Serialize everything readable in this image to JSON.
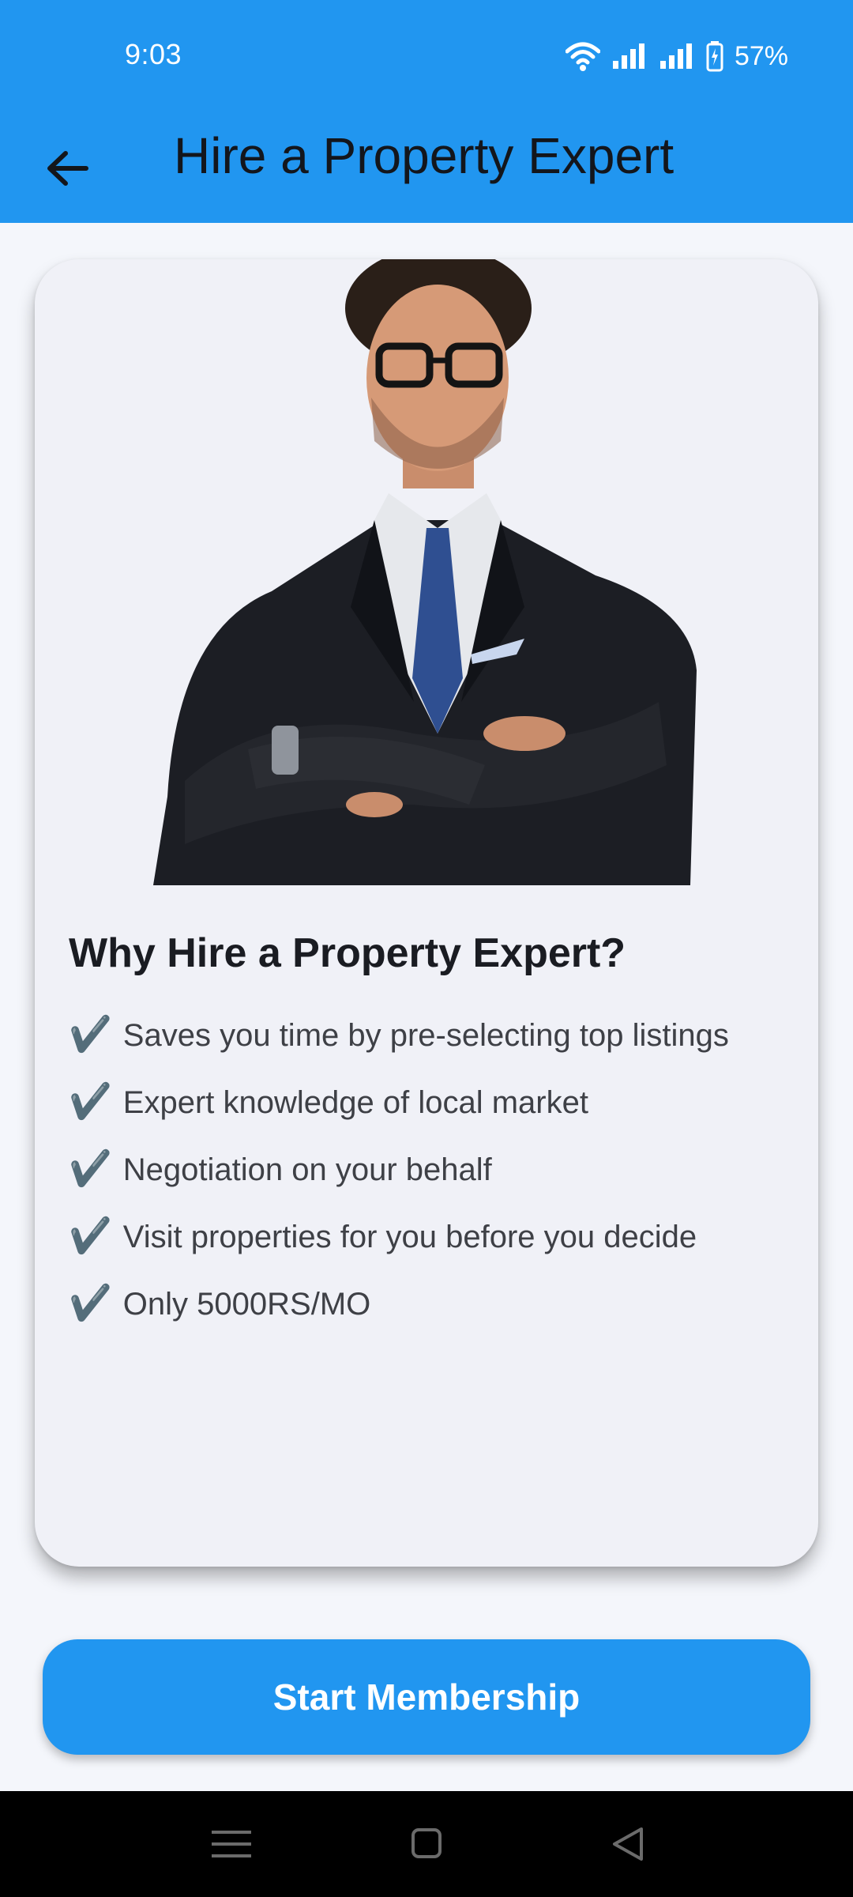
{
  "status_bar": {
    "time": "9:03",
    "battery_percent": "57%",
    "icons": [
      "wifi-icon",
      "signal-icon",
      "signal-icon",
      "battery-charging-icon"
    ]
  },
  "app_bar": {
    "title": "Hire a Property Expert",
    "back_icon": "arrow-left-icon"
  },
  "card": {
    "heading": "Why Hire a Property Expert?",
    "check_glyph": "✔️",
    "benefits": [
      "Saves you time by pre-selecting top listings",
      "Expert knowledge of local market",
      "Negotiation on your behalf",
      "Visit properties for you before you decide",
      "Only 5000RS/MO"
    ]
  },
  "cta": {
    "label": "Start Membership"
  },
  "nav_bar": {
    "icons": [
      "menu-icon",
      "home-square-icon",
      "back-triangle-icon"
    ]
  },
  "colors": {
    "primary": "#2196F0",
    "card_background": "#F0F1F7",
    "page_background": "#F4F6FB"
  }
}
